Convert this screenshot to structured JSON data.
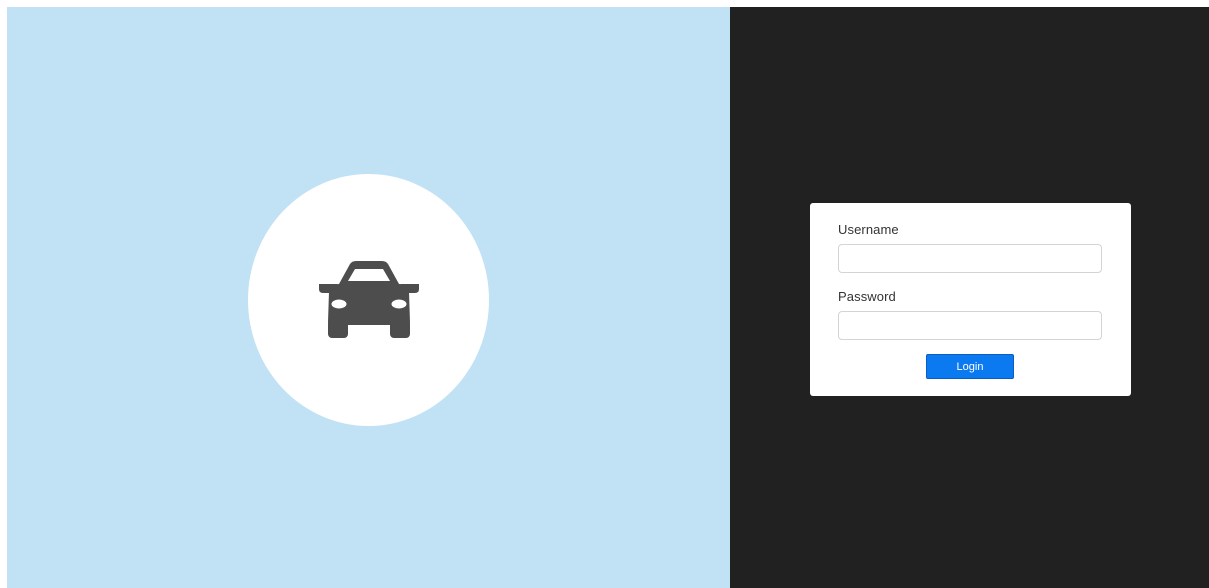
{
  "colors": {
    "left_panel_bg": "#c1e1f5",
    "right_panel_bg": "#212121",
    "logo_circle_bg": "#ffffff",
    "logo_icon": "#4d4d4d",
    "login_button_bg": "#0b7af0"
  },
  "brand": {
    "icon": "car-icon"
  },
  "login_form": {
    "username_label": "Username",
    "username_value": "",
    "password_label": "Password",
    "password_value": "",
    "submit_label": "Login"
  }
}
